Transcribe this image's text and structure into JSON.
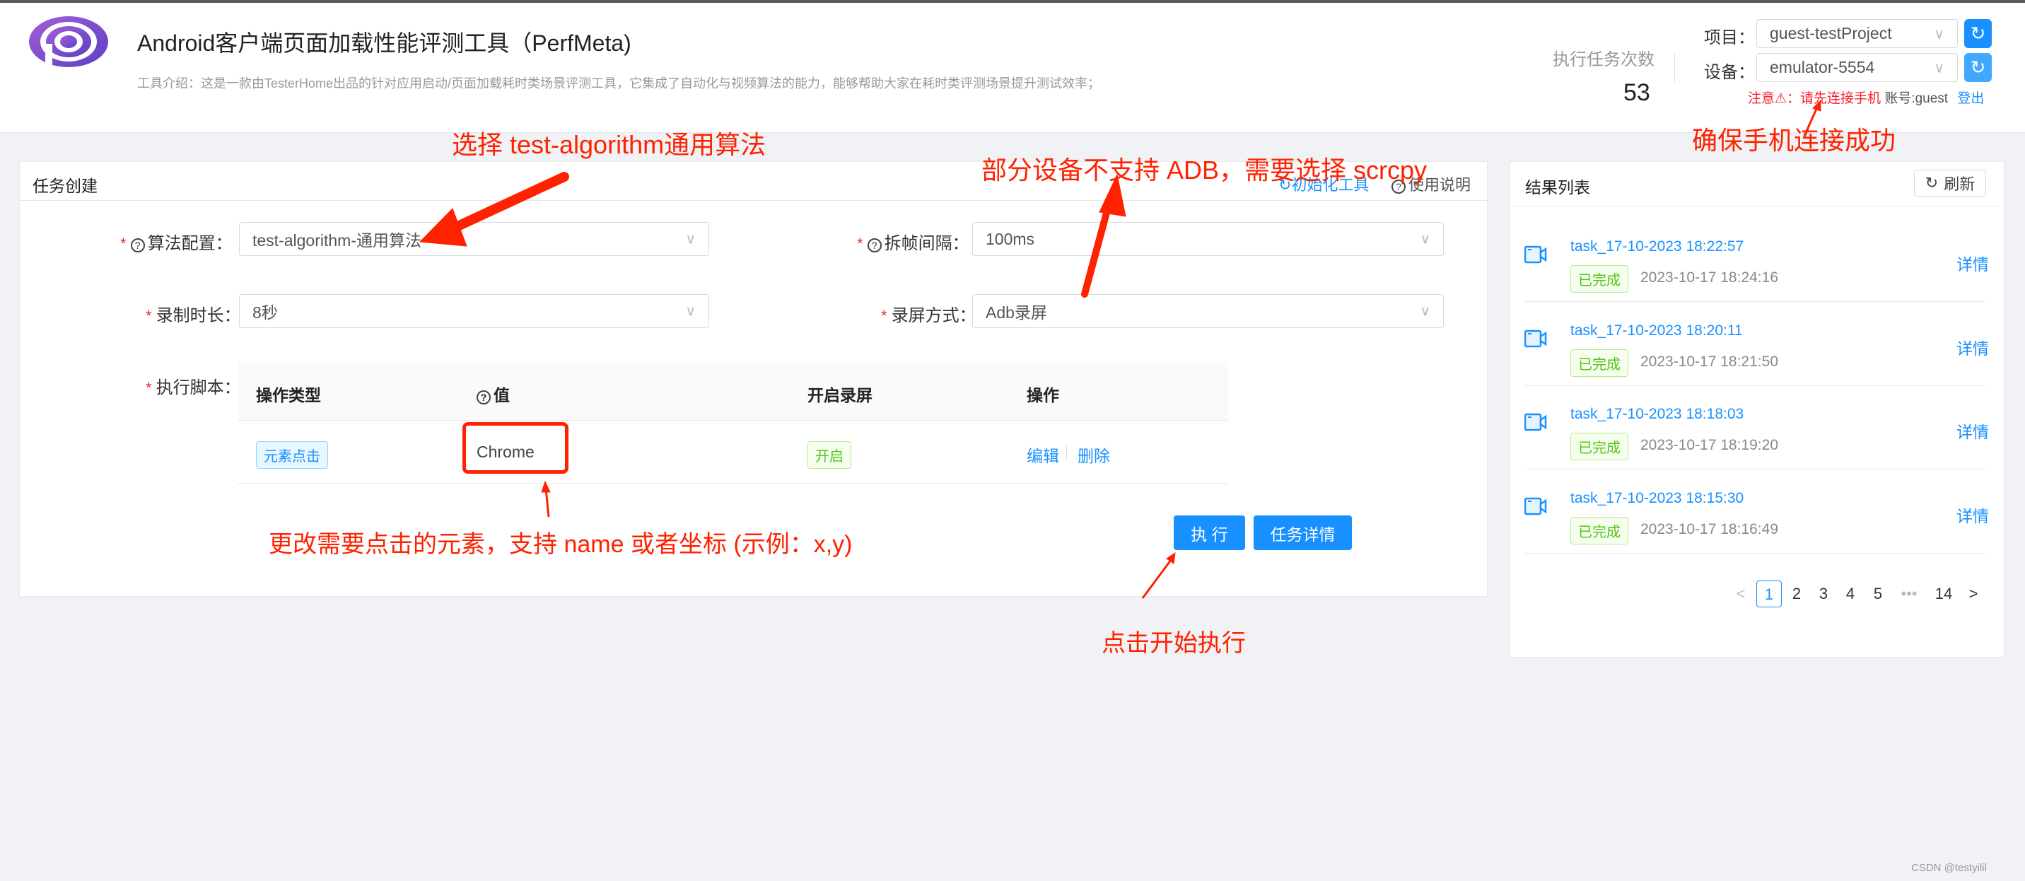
{
  "header": {
    "title": "Android客户端页面加载性能评测工具（PerfMeta)",
    "intro": "工具介绍：这是一款由TesterHome出品的针对应用启动/页面加载耗时类场景评测工具，它集成了自动化与视频算法的能力，能够帮助大家在耗时类评测场景提升测试效率；",
    "stat_label": "执行任务次数",
    "stat_value": "53",
    "project_label": "项目：",
    "project_value": "guest-testProject",
    "device_label": "设备：",
    "device_value": "emulator-5554",
    "warning": "注意⚠：请先连接手机",
    "account": "账号:guest",
    "logout": "登出"
  },
  "task": {
    "title": "任务创建",
    "init_tool": "初始化工具",
    "help": "使用说明",
    "fields": [
      {
        "label": "算法配置：",
        "value": "test-algorithm-通用算法"
      },
      {
        "label": "拆帧间隔：",
        "value": "100ms"
      },
      {
        "label": "录制时长：",
        "value": "8秒"
      },
      {
        "label": "录屏方式：",
        "value": "Adb录屏"
      }
    ],
    "script_label": "执行脚本：",
    "columns": [
      "操作类型",
      "值",
      "开启录屏",
      "操作"
    ],
    "rows": [
      {
        "type": "元素点击",
        "value": "Chrome",
        "record": "开启",
        "edit": "编辑",
        "delete": "删除"
      }
    ],
    "execute": "执 行",
    "details": "任务详情"
  },
  "results": {
    "title": "结果列表",
    "refresh": "刷新",
    "items": [
      {
        "name": "task_17-10-2023 18:22:57",
        "status": "已完成",
        "time": "2023-10-17 18:24:16",
        "action": "详情"
      },
      {
        "name": "task_17-10-2023 18:20:11",
        "status": "已完成",
        "time": "2023-10-17 18:21:50",
        "action": "详情"
      },
      {
        "name": "task_17-10-2023 18:18:03",
        "status": "已完成",
        "time": "2023-10-17 18:19:20",
        "action": "详情"
      },
      {
        "name": "task_17-10-2023 18:15:30",
        "status": "已完成",
        "time": "2023-10-17 18:16:49",
        "action": "详情"
      }
    ],
    "pagination": {
      "pages": [
        "1",
        "2",
        "3",
        "4",
        "5",
        "•••",
        "14"
      ],
      "current": "1"
    }
  },
  "annotations": {
    "algo": "选择 test-algorithm通用算法",
    "adb": "部分设备不支持 ADB，需要选择 scrcpy",
    "phone": "确保手机连接成功",
    "element": "更改需要点击的元素，支持 name 或者坐标 (示例：x,y)",
    "start": "点击开始执行"
  },
  "watermark": "CSDN @testyilil",
  "colors": {
    "primary": "#1890ff",
    "annotation": "#ff2200",
    "success": "#52c41a"
  }
}
